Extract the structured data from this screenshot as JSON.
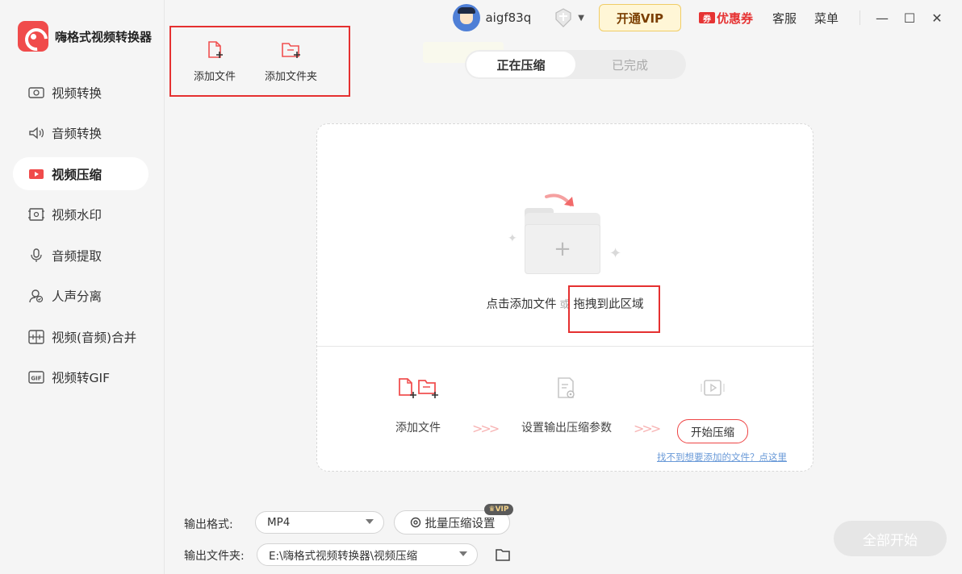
{
  "app": {
    "title": "嗨格式视频转换器",
    "brand_color": "#f04b4b"
  },
  "sidebar": {
    "items": [
      {
        "label": "视频转换",
        "icon": "video-convert-icon",
        "active": false
      },
      {
        "label": "音频转换",
        "icon": "audio-convert-icon",
        "active": false
      },
      {
        "label": "视频压缩",
        "icon": "video-compress-icon",
        "active": true
      },
      {
        "label": "视频水印",
        "icon": "video-watermark-icon",
        "active": false
      },
      {
        "label": "音频提取",
        "icon": "audio-extract-icon",
        "active": false
      },
      {
        "label": "人声分离",
        "icon": "vocal-separate-icon",
        "active": false
      },
      {
        "label": "视频(音频)合并",
        "icon": "merge-icon",
        "active": false
      },
      {
        "label": "视频转GIF",
        "icon": "gif-icon",
        "active": false
      }
    ]
  },
  "titlebar": {
    "username": "aigf83q",
    "vip_label": "开通VIP",
    "coupon_label": "优惠券",
    "service_label": "客服",
    "menu_label": "菜单"
  },
  "toolbar": {
    "add_file": "添加文件",
    "add_folder": "添加文件夹"
  },
  "tabs": [
    {
      "label": "正在压缩",
      "active": true
    },
    {
      "label": "已完成",
      "active": false
    }
  ],
  "dropzone": {
    "click_text": "点击添加文件",
    "or_text": "或",
    "drag_text": "拖拽到此区域",
    "steps": {
      "add_file": "添加文件",
      "set_params": "设置输出压缩参数",
      "start": "开始压缩"
    },
    "help_link": "找不到想要添加的文件？点这里"
  },
  "bottom": {
    "format_label": "输出格式:",
    "format_value": "MP4",
    "batch_label": "批量压缩设置",
    "vip_badge": "VIP",
    "folder_label": "输出文件夹:",
    "folder_value": "E:\\嗨格式视频转换器\\视频压缩",
    "start_all": "全部开始"
  },
  "colors": {
    "accent": "#e53030",
    "highlight_box": "#e53030",
    "disabled_button": "#e6e6e6"
  }
}
